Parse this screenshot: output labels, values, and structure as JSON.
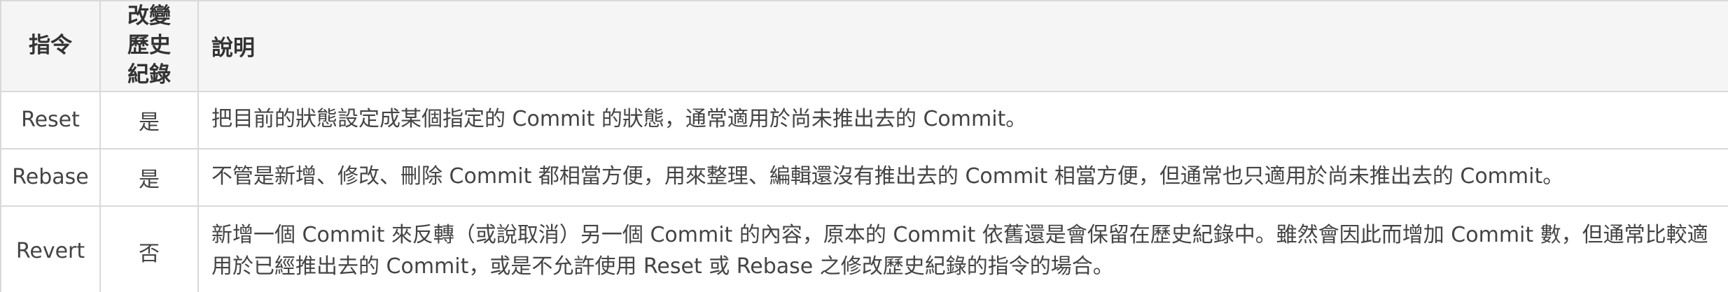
{
  "table": {
    "headers": {
      "command": "指令",
      "changes_history": "改變歷史紀錄",
      "description": "說明"
    },
    "rows": [
      {
        "command": "Reset",
        "changes_history": "是",
        "description": "把目前的狀態設定成某個指定的 Commit 的狀態，通常適用於尚未推出去的 Commit。"
      },
      {
        "command": "Rebase",
        "changes_history": "是",
        "description": "不管是新增、修改、刪除 Commit 都相當方便，用來整理、編輯還沒有推出去的 Commit 相當方便，但通常也只適用於尚未推出去的 Commit。"
      },
      {
        "command": "Revert",
        "changes_history": "否",
        "description": "新增一個 Commit 來反轉（或說取消）另一個 Commit 的內容，原本的 Commit 依舊還是會保留在歷史紀錄中。雖然會因此而增加 Commit 數，但通常比較適用於已經推出去的 Commit，或是不允許使用 Reset 或 Rebase 之修改歷史紀錄的指令的場合。"
      }
    ]
  }
}
